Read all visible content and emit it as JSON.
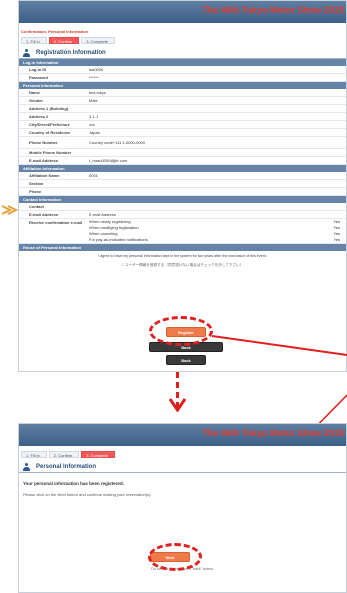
{
  "event_title": "The 46th Tokyo Motor Show 2019",
  "page1": {
    "breadcrumb": "Confirmation, Personal Information",
    "steps": [
      "1. Fill in",
      "2. Confirm",
      "3. Complete"
    ],
    "section_title": "Registration Information",
    "login": {
      "header": "Log-in Information",
      "rows": [
        {
          "label": "Log-in ID",
          "value": "tse0000"
        },
        {
          "label": "Password",
          "value": "******"
        }
      ]
    },
    "personal": {
      "header": "Personal Information",
      "rows": [
        {
          "label": "Name",
          "value": "tms tokyo"
        },
        {
          "label": "Gender",
          "value": "Male"
        },
        {
          "label": "Address 1 (Building)",
          "value": ""
        },
        {
          "label": "Address 2",
          "value": "3-1-1"
        },
        {
          "label": "City/Direct/Prefecture",
          "value": "xxx"
        },
        {
          "label": "Country of Residence",
          "value": "Japan"
        },
        {
          "label": "Phone Number",
          "value": "Country code+111 1-0000-0000"
        },
        {
          "label": "Mobile Phone Number",
          "value": ""
        },
        {
          "label": "E-mail Address",
          "value": "t_maru0000@jtb.com"
        }
      ]
    },
    "affiliation": {
      "header": "Affiliation Information",
      "rows": [
        {
          "label": "Affiliation Name",
          "value": "0001"
        },
        {
          "label": "Section",
          "value": ""
        },
        {
          "label": "Phone",
          "value": ""
        }
      ]
    },
    "contact": {
      "header": "Contact Information",
      "rows": [
        {
          "label": "Contact",
          "value": ""
        },
        {
          "label": "E-mail Address",
          "value": "E-mail Address"
        }
      ],
      "receive_label": "Receive confirmation e-mail",
      "receive_rows": [
        {
          "label": "When newly registering",
          "value": "Yes"
        },
        {
          "label": "When modifying registration",
          "value": "Yes"
        },
        {
          "label": "When canceling",
          "value": "Yes"
        },
        {
          "label": "For pay-as-indicated notifications",
          "value": "Yes"
        }
      ]
    },
    "reuse": {
      "header": "Reuse of Personal Information",
      "terms": "I agree to have my personal information kept in the system for two years after the conclusion of this event.",
      "check_text": "□ ユーザー情報を登録する（同意頂けない場合はチェックを外して下さい）"
    },
    "buttons": {
      "register": "Register",
      "back": "Back",
      "cancel": "Back"
    }
  },
  "page2": {
    "steps": [
      "1. Fill in",
      "2. Confirm",
      "3. Complete"
    ],
    "section_title": "Personal Information",
    "message": "Your personal information has been registered.",
    "instruction": "Please click on the Next button and continue making your reservation(s).",
    "next_button": "Next",
    "note": "Do not use the browser's \"back\" button."
  },
  "colors": {
    "accent_red": "#e01f1f",
    "header_blue": "#3d5f86",
    "button_orange": "#ef7b4b"
  }
}
